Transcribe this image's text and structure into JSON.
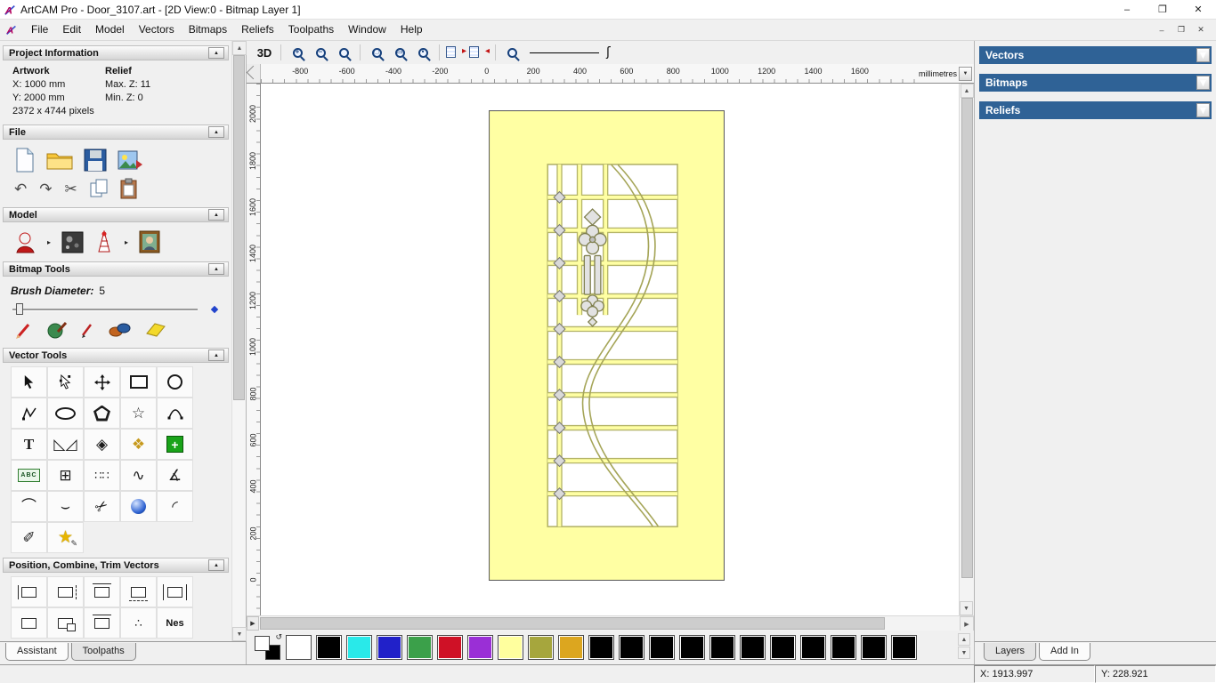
{
  "titlebar": {
    "title": "ArtCAM Pro - Door_3107.art - [2D View:0 - Bitmap Layer 1]"
  },
  "menus": [
    "File",
    "Edit",
    "Model",
    "Vectors",
    "Bitmaps",
    "Reliefs",
    "Toolpaths",
    "Window",
    "Help"
  ],
  "toolbar": {
    "view3d_label": "3D"
  },
  "assistant": {
    "project": {
      "title": "Project Information",
      "artwork_header": "Artwork",
      "relief_header": "Relief",
      "x_value": "X: 1000 mm",
      "y_value": "Y: 2000 mm",
      "max_z": "Max. Z: 11",
      "min_z": "Min. Z: 0",
      "pixels": "2372 x 4744 pixels"
    },
    "file_title": "File",
    "model_title": "Model",
    "bitmap_title": "Bitmap Tools",
    "brush_label": "Brush Diameter:",
    "brush_value": "5",
    "vector_title": "Vector Tools",
    "position_title": "Position, Combine, Trim Vectors",
    "labels": {
      "text_tool": "T",
      "abc_tool": "ABC",
      "nesting_tool": "Nes"
    },
    "tabs": [
      "Assistant",
      "Toolpaths"
    ]
  },
  "ruler": {
    "top": [
      "-800",
      "-600",
      "-400",
      "-200",
      "0",
      "200",
      "400",
      "600",
      "800",
      "1000",
      "1200",
      "1400",
      "1600"
    ],
    "left": [
      "2000",
      "1800",
      "1600",
      "1400",
      "1200",
      "1000",
      "800",
      "600",
      "400",
      "200",
      "0"
    ],
    "units": "millimetres"
  },
  "right_panel": {
    "headers": [
      "Vectors",
      "Bitmaps",
      "Reliefs"
    ],
    "header_color": "#2f6296",
    "tabs": [
      "Layers",
      "Add In"
    ]
  },
  "palette": {
    "colors": [
      "#ffffff",
      "#000000",
      "#29e9e9",
      "#2121c9",
      "#3ba04a",
      "#cf1126",
      "#9a2fd6",
      "#ffff9e",
      "#a6a63d",
      "#dca61f",
      "#000000",
      "#000000",
      "#000000",
      "#000000",
      "#000000",
      "#000000",
      "#000000",
      "#000000",
      "#000000",
      "#000000",
      "#000000"
    ]
  },
  "status": {
    "x": "X: 1913.997",
    "y": "Y: 228.921"
  }
}
